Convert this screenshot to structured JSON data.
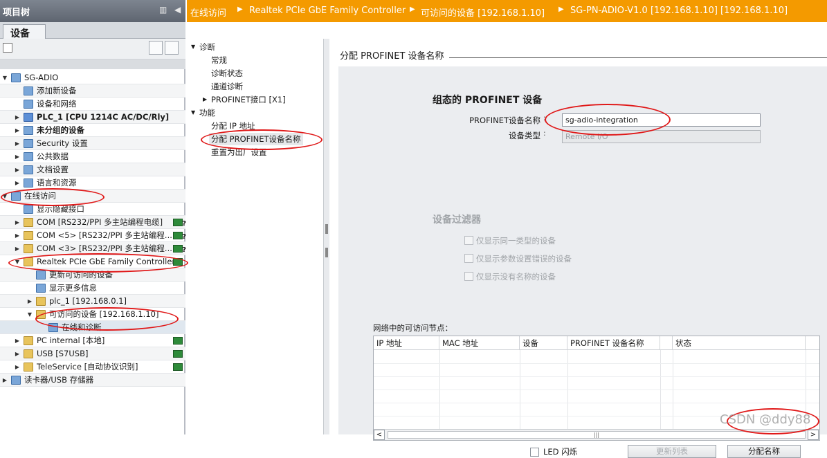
{
  "project_tree": {
    "title": "项目树",
    "controls": {
      "layout_icon": "panel-layout-icon",
      "collapse_icon": "collapse-left-icon"
    },
    "tab_devices": "设备",
    "items": [
      {
        "label": "SG-ADIO",
        "arrow": "▼",
        "icon": "project-icon"
      },
      {
        "label": "添加新设备",
        "arrow": "",
        "icon": "add-device-icon"
      },
      {
        "label": "设备和网络",
        "arrow": "",
        "icon": "network-icon"
      },
      {
        "label": "PLC_1 [CPU 1214C AC/DC/Rly]",
        "arrow": "▶",
        "icon": "plc-icon"
      },
      {
        "label": "未分组的设备",
        "arrow": "▶",
        "icon": "ungrouped-icon"
      },
      {
        "label": "Security 设置",
        "arrow": "▶",
        "icon": "security-icon"
      },
      {
        "label": "公共数据",
        "arrow": "▶",
        "icon": "common-data-icon"
      },
      {
        "label": "文档设置",
        "arrow": "▶",
        "icon": "document-icon"
      },
      {
        "label": "语言和资源",
        "arrow": "▶",
        "icon": "language-icon"
      },
      {
        "label": "在线访问",
        "arrow": "▼",
        "icon": "online-access-icon"
      },
      {
        "label": "显示隐藏接口",
        "arrow": "",
        "icon": "show-hidden-icon"
      },
      {
        "label": "COM [RS232/PPI 多主站编程电缆]",
        "arrow": "▶",
        "icon": "folder-icon"
      },
      {
        "label": "COM <5> [RS232/PPI 多主站编程...",
        "arrow": "▶",
        "icon": "folder-icon"
      },
      {
        "label": "COM <3> [RS232/PPI 多主站编程...",
        "arrow": "▶",
        "icon": "folder-icon"
      },
      {
        "label": "Realtek PCIe GbE Family Controller",
        "arrow": "▼",
        "icon": "folder-icon"
      },
      {
        "label": "更新可访问的设备",
        "arrow": "",
        "icon": "update-devices-icon"
      },
      {
        "label": "显示更多信息",
        "arrow": "",
        "icon": "more-info-icon"
      },
      {
        "label": "plc_1 [192.168.0.1]",
        "arrow": "▶",
        "icon": "folder-icon"
      },
      {
        "label": "可访问的设备 [192.168.1.10]",
        "arrow": "▼",
        "icon": "folder-icon"
      },
      {
        "label": "在线和诊断",
        "arrow": "",
        "icon": "diagnostics-icon"
      },
      {
        "label": "PC internal [本地]",
        "arrow": "▶",
        "icon": "folder-icon"
      },
      {
        "label": "USB [S7USB]",
        "arrow": "▶",
        "icon": "folder-icon"
      },
      {
        "label": "TeleService [自动协议识别]",
        "arrow": "▶",
        "icon": "folder-icon"
      },
      {
        "label": "读卡器/USB 存储器",
        "arrow": "▶",
        "icon": "card-reader-icon"
      }
    ]
  },
  "breadcrumb": {
    "segments": [
      "在线访问",
      "Realtek PCIe GbE Family Controller",
      "可访问的设备 [192.168.1.10]",
      "SG-PN-ADIO-V1.0 [192.168.1.10] [192.168.1.10]"
    ],
    "separator": "▶"
  },
  "nav": {
    "diagnostics": "诊断",
    "general": "常规",
    "diag_status": "诊断状态",
    "channel_diag": "通道诊断",
    "profinet_port": "PROFINET接口 [X1]",
    "functions": "功能",
    "assign_ip": "分配 IP 地址",
    "assign_name": "分配 PROFINET设备名称",
    "reset_factory": "重置为出厂设置"
  },
  "main": {
    "section_title": "分配 PROFINET 设备名称",
    "configured_heading": "组态的 PROFINET 设备",
    "device_name_label": "PROFINET设备名称",
    "device_name_value": "sg-adio-integration",
    "device_type_label": "设备类型",
    "device_type_value": "Remote I/O",
    "filter_heading": "设备过滤器",
    "filter_same_type": "仅显示同一类型的设备",
    "filter_param_error": "仅显示参数设置错误的设备",
    "filter_no_name": "仅显示没有名称的设备",
    "nodes_label": "网络中的可访问节点：",
    "table_columns": [
      "IP 地址",
      "MAC 地址",
      "设备",
      "PROFINET 设备名称",
      "状态"
    ],
    "led_flash": "LED 闪烁",
    "update_list": "更新列表",
    "assign_name_button": "分配名称"
  },
  "watermark": "CSDN @ddy88",
  "colors": {
    "header_orange": "#f49a00",
    "annotation_red": "#e01818",
    "tree_title_gray": "#6a717c"
  }
}
